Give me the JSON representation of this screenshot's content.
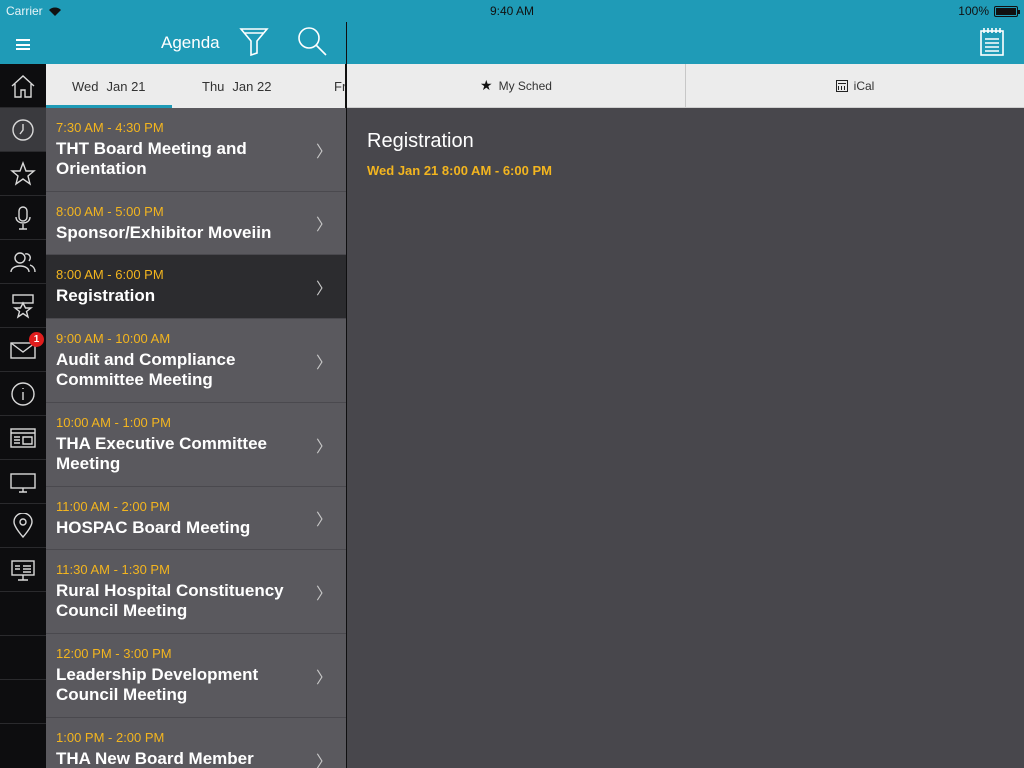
{
  "status": {
    "carrier": "Carrier",
    "time": "9:40 AM",
    "battery": "100%"
  },
  "header": {
    "title": "Agenda"
  },
  "rail": {
    "badge_count": "1"
  },
  "date_tabs": [
    {
      "day": "Wed",
      "date": "Jan 21"
    },
    {
      "day": "Thu",
      "date": "Jan 22"
    },
    {
      "day": "Fr",
      "date": ""
    }
  ],
  "toolbar": {
    "my_sched": "My Sched",
    "ical": "iCal"
  },
  "sessions": [
    {
      "time": "7:30 AM - 4:30 PM",
      "name": "THT Board Meeting and Orientation"
    },
    {
      "time": "8:00 AM - 5:00 PM",
      "name": "Sponsor/Exhibitor Moveiin"
    },
    {
      "time": "8:00 AM - 6:00 PM",
      "name": "Registration"
    },
    {
      "time": "9:00 AM - 10:00 AM",
      "name": "Audit and Compliance Committee Meeting"
    },
    {
      "time": "10:00 AM - 1:00 PM",
      "name": "THA Executive Committee Meeting"
    },
    {
      "time": "11:00 AM - 2:00 PM",
      "name": "HOSPAC Board Meeting"
    },
    {
      "time": "11:30 AM - 1:30 PM",
      "name": "Rural Hospital Constituency Council Meeting"
    },
    {
      "time": "12:00 PM - 3:00 PM",
      "name": "Leadership Development Council Meeting"
    },
    {
      "time": "1:00 PM - 2:00 PM",
      "name": "THA New Board Member"
    }
  ],
  "detail": {
    "title": "Registration",
    "datetime": "Wed  Jan 21 8:00 AM - 6:00 PM"
  }
}
